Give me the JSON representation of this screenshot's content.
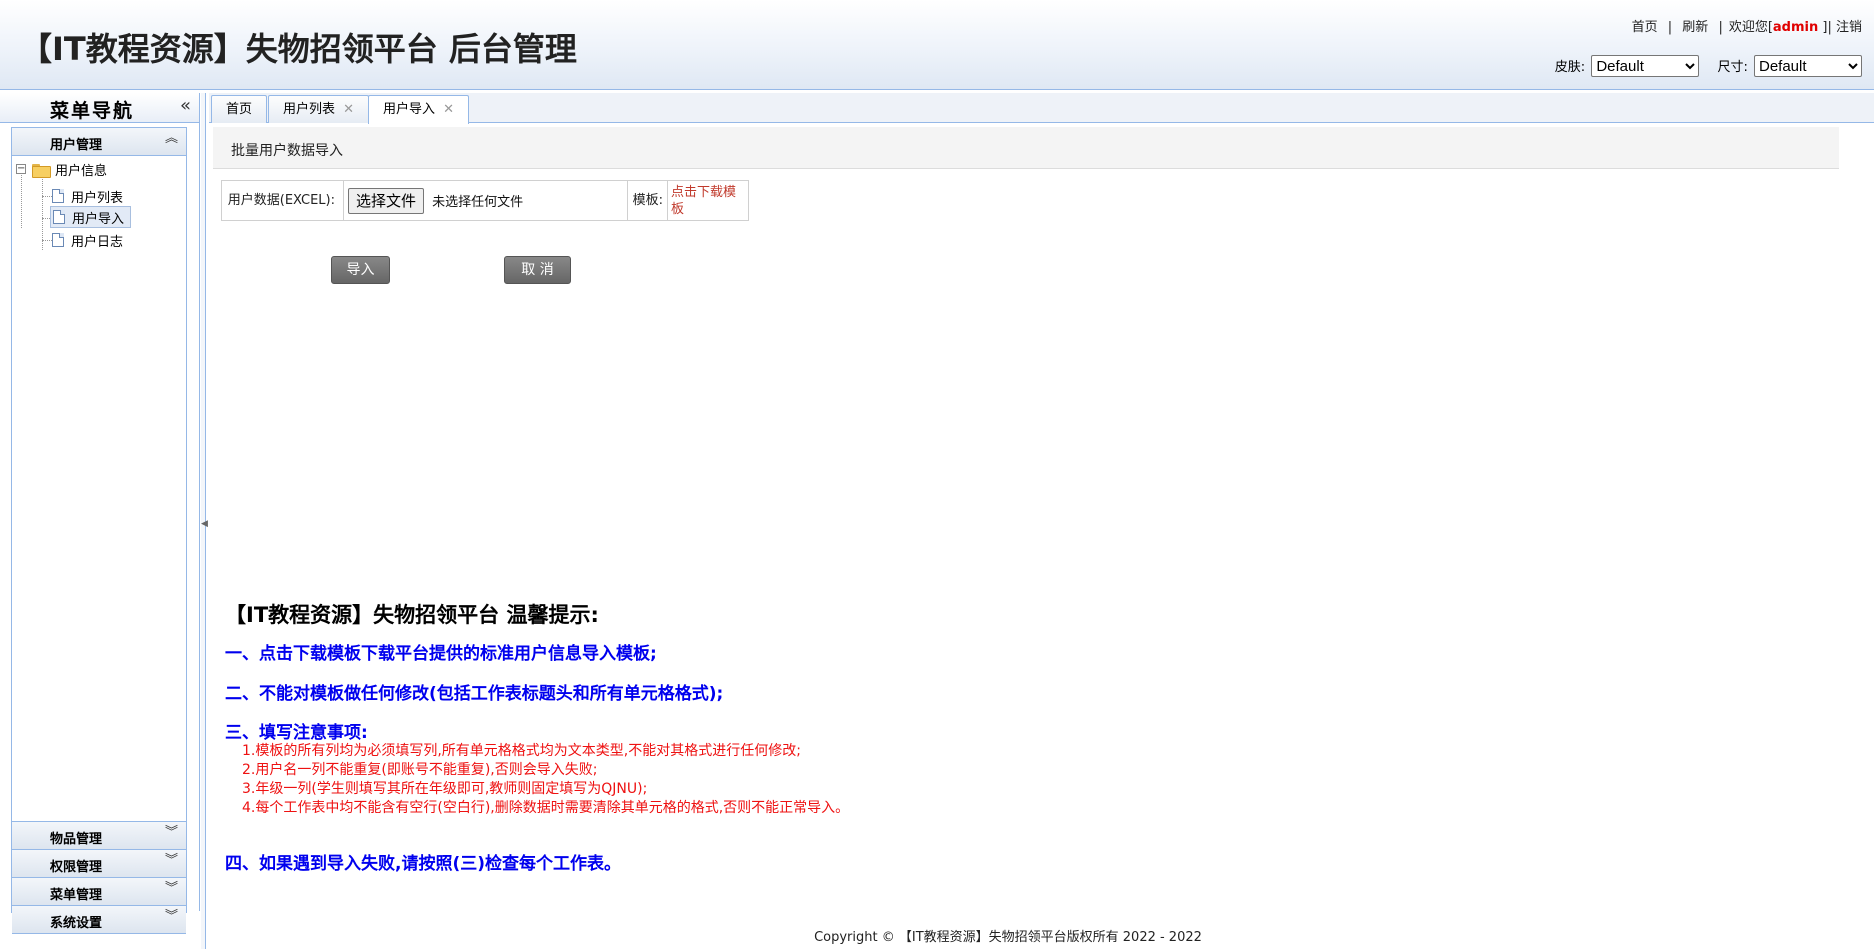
{
  "header": {
    "title": "【IT教程资源】失物招领平台 后台管理",
    "links": {
      "home": "首页",
      "sep": "|",
      "refresh": "刷新",
      "welcome_prefix": "欢迎您[",
      "user": "admin",
      "welcome_suffix": "]|",
      "logout": "注销"
    },
    "skin_label": "皮肤:",
    "skin_value": "Default",
    "size_label": "尺寸:",
    "size_value": "Default"
  },
  "sidebar": {
    "title": "菜单导航",
    "collapse_icon": "«",
    "sections": [
      {
        "label": "用户管理",
        "chevron": "︽"
      },
      {
        "label": "物品管理",
        "chevron": "︾"
      },
      {
        "label": "权限管理",
        "chevron": "︾"
      },
      {
        "label": "菜单管理",
        "chevron": "︾"
      },
      {
        "label": "系统设置",
        "chevron": "︾"
      }
    ],
    "tree": {
      "root": "用户信息",
      "toggle": "−",
      "children": [
        "用户列表",
        "用户导入",
        "用户日志"
      ],
      "selected_index": 1
    }
  },
  "tabs": [
    {
      "label": "首页",
      "closable": false
    },
    {
      "label": "用户列表",
      "closable": true
    },
    {
      "label": "用户导入",
      "closable": true,
      "active": true
    }
  ],
  "tab_close_glyph": "✕",
  "main": {
    "section_title": "批量用户数据导入",
    "form": {
      "data_label": "用户数据(EXCEL):",
      "file_button": "选择文件",
      "file_status": "未选择任何文件",
      "template_label": "模板:",
      "template_link": "点击下载模板"
    },
    "import_button": "导入",
    "cancel_button": "取 消",
    "tips": {
      "title": "【IT教程资源】失物招领平台 温馨提示:",
      "tip1": "一、点击下载模板下载平台提供的标准用户信息导入模板;",
      "tip2": "二、不能对模板做任何修改(包括工作表标题头和所有单元格格式);",
      "tip3": "三、填写注意事项:",
      "tip3_items": [
        "1.模板的所有列均为必须填写列,所有单元格格式均为文本类型,不能对其格式进行任何修改;",
        "2.用户名一列不能重复(即账号不能重复),否则会导入失败;",
        "3.年级一列(学生则填写其所在年级即可,教师则固定填写为QJNU);",
        "4.每个工作表中均不能含有空行(空白行),删除数据时需要清除其单元格的格式,否则不能正常导入。"
      ],
      "tip4": "四、如果遇到导入失败,请按照(三)检查每个工作表。"
    }
  },
  "footer": "Copyright © 【IT教程资源】失物招领平台版权所有 2022 - 2022",
  "colors": {
    "border": "#95b8e7",
    "link_red": "#c0392b",
    "tip_blue": "#0000ee",
    "tip_red": "#ee1111",
    "admin_red": "#e00000"
  }
}
